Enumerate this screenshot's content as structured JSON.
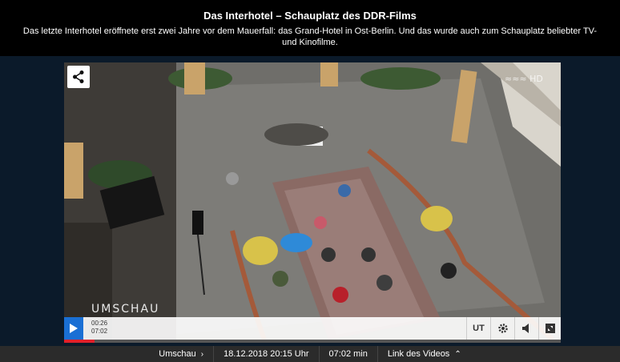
{
  "header": {
    "title": "Das Interhotel – Schauplatz des DDR-Films",
    "description": "Das letzte Interhotel eröffnete erst zwei Jahre vor dem Mauerfall: das Grand-Hotel in Ost-Berlin. Und das wurde auch zum Schauplatz beliebter TV- und Kinofilme."
  },
  "player": {
    "brand": "UMSCHAU",
    "hd_label": "HD",
    "current_time": "00:26",
    "duration": "07:02",
    "progress_fraction": 0.062,
    "subtitle_label": "UT",
    "icons": {
      "share": "share-icon",
      "play": "play-icon",
      "settings": "gear-icon",
      "volume": "volume-icon",
      "fullscreen": "fullscreen-icon"
    },
    "colors": {
      "play_button": "#1a6fd4",
      "progress": "#e0202a"
    }
  },
  "bottombar": {
    "program": "Umschau",
    "date": "18.12.2018 20:15 Uhr",
    "length": "07:02 min",
    "link": "Link des Videos"
  }
}
